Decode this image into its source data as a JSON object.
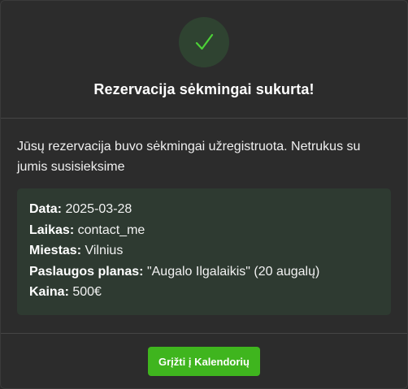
{
  "dialog": {
    "title": "Rezervacija sėkmingai sukurta!",
    "icon": "checkmark-icon",
    "accent_color": "#3fb51e",
    "message": "Jūsų rezervacija buvo sėkmingai užregistruota. Netrukus su jumis susisieksime"
  },
  "details": {
    "date_label": "Data:",
    "date_value": "2025-03-28",
    "time_label": "Laikas:",
    "time_value": "contact_me",
    "city_label": "Miestas:",
    "city_value": "Vilnius",
    "plan_label": "Paslaugos planas:",
    "plan_value": "\"Augalo Ilgalaikis\" (20 augalų)",
    "price_label": "Kaina:",
    "price_value": "500€"
  },
  "footer": {
    "back_button_label": "Grįžti į Kalendorių"
  }
}
